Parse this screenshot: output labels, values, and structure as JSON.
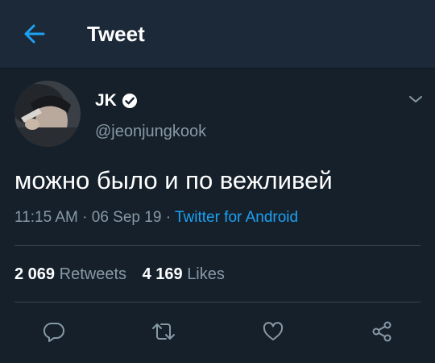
{
  "header": {
    "title": "Tweet",
    "back_icon": "arrow-left-icon"
  },
  "tweet": {
    "author": {
      "display_name": "JK",
      "handle": "@jeonjungkook",
      "verified": true
    },
    "text": "можно было и по вежливей",
    "time": "11:15 AM",
    "date": "06 Sep 19",
    "source": "Twitter for Android",
    "separator": "·",
    "stats": {
      "retweets_count": "2 069",
      "retweets_label": "Retweets",
      "likes_count": "4 169",
      "likes_label": "Likes"
    },
    "actions": [
      "reply-icon",
      "retweet-icon",
      "like-icon",
      "share-icon"
    ]
  },
  "colors": {
    "background": "#15202b",
    "header_background": "#1c2938",
    "accent": "#1da1f2",
    "muted_text": "#8899a6",
    "divider": "#38444d"
  }
}
